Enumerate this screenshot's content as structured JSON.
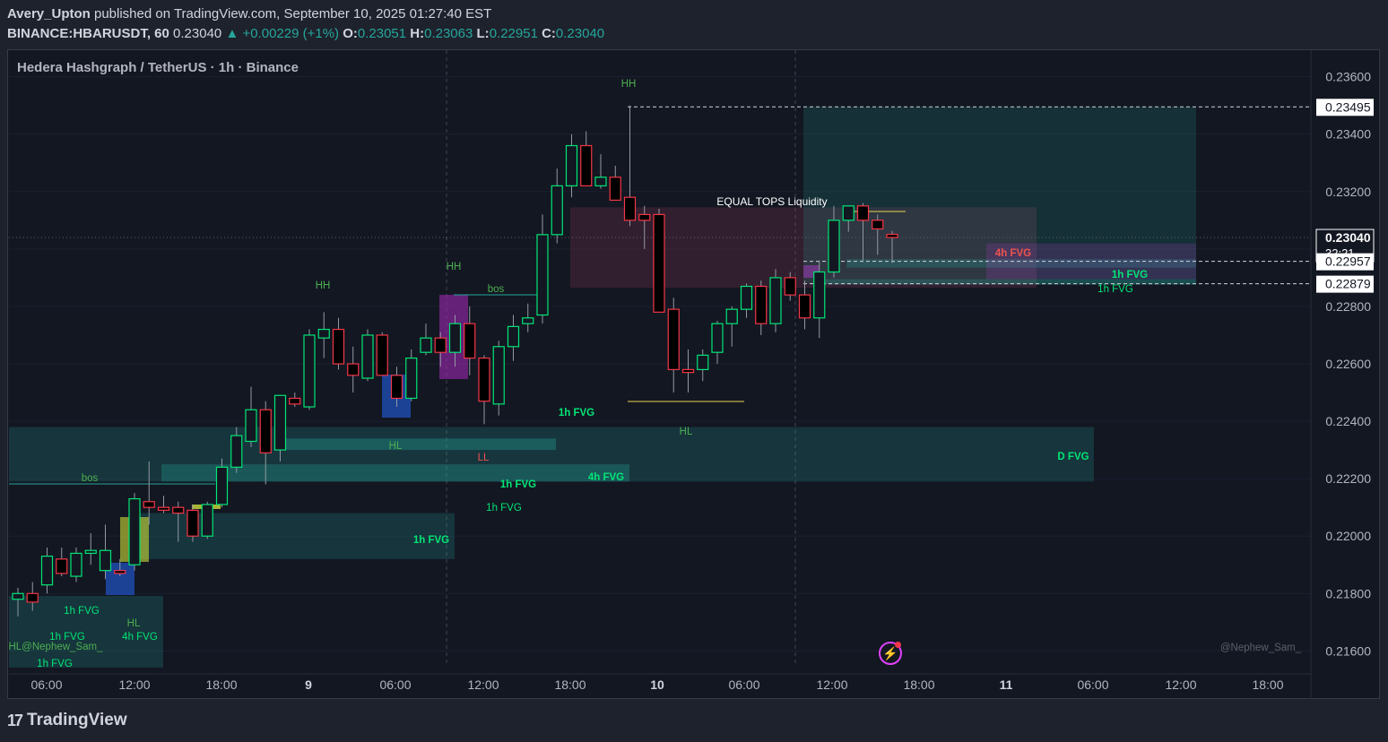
{
  "header": {
    "author": "Avery_Upton",
    "published_text": "published on TradingView.com, September 10, 2025 01:27:40 EST",
    "symbol": "BINANCE:HBARUSDT, 60",
    "price": "0.23040",
    "change": "▲ +0.00229 (+1%)",
    "o_label": "O:",
    "o": "0.23051",
    "h_label": "H:",
    "h": "0.23063",
    "l_label": "L:",
    "l": "0.22951",
    "c_label": "C:",
    "c": "0.23040"
  },
  "legend": {
    "title": "Hedera Hashgraph / TetherUS · 1h · Binance"
  },
  "colors": {
    "up": "#26a69a",
    "down": "#ef5350",
    "bg": "#131722",
    "accent": "#e040fb"
  },
  "chart_data": {
    "type": "candlestick",
    "y_axis": {
      "ylim": [
        0.2152,
        0.2368
      ],
      "ticks": [
        "0.23600",
        "0.23400",
        "0.23200",
        "0.23000",
        "0.22800",
        "0.22600",
        "0.22400",
        "0.22200",
        "0.22000",
        "0.21800",
        "0.21600"
      ]
    },
    "x_axis": {
      "tick_labels": [
        "06:00",
        "12:00",
        "18:00",
        "9",
        "06:00",
        "12:00",
        "18:00",
        "10",
        "06:00",
        "12:00",
        "18:00",
        "11",
        "06:00",
        "12:00",
        "18:00"
      ]
    },
    "price_labels": [
      {
        "value": "0.23495",
        "style": "white"
      },
      {
        "value": "0.23040",
        "countdown": "32:21",
        "style": "current"
      },
      {
        "value": "0.22957",
        "style": "white"
      },
      {
        "value": "0.22879",
        "style": "white"
      }
    ],
    "zones": [
      {
        "label": "D FVG",
        "from": 0.2219,
        "to": 0.2238,
        "kind": "green"
      },
      {
        "label": "4h FVG",
        "from": 0.22865,
        "to": 0.23145,
        "kind": "red"
      },
      {
        "label": "4h FVG",
        "from": 0.2219,
        "to": 0.2225,
        "kind": "green"
      },
      {
        "label": "1h FVG",
        "from": 0.2192,
        "to": 0.2208,
        "kind": "green"
      },
      {
        "label": "1h FVG",
        "from": 0.223,
        "to": 0.2234,
        "kind": "teal"
      },
      {
        "label": "1h FVG",
        "from": 0.22935,
        "to": 0.22965,
        "kind": "green"
      },
      {
        "label": "1h FVG",
        "from": 0.22875,
        "to": 0.22895,
        "kind": "green"
      }
    ],
    "annotations": [
      "HH",
      "HH",
      "HH",
      "HL",
      "HL",
      "HL",
      "LL",
      "bos",
      "bos",
      "EQUAL TOPS Liquidity",
      "1h FVG",
      "1h FVG",
      "1h FVG",
      "4h FVG",
      "1h FVG",
      "HL@Nephew_Sam_",
      "1h FVG"
    ],
    "watermark": "@Nephew_Sam_",
    "candles": [
      [
        0.2178,
        0.2182,
        0.2172,
        0.218
      ],
      [
        0.218,
        0.2184,
        0.2174,
        0.2177
      ],
      [
        0.2183,
        0.2196,
        0.218,
        0.2193
      ],
      [
        0.2192,
        0.2196,
        0.2186,
        0.2187
      ],
      [
        0.2186,
        0.2196,
        0.2184,
        0.2194
      ],
      [
        0.2194,
        0.2201,
        0.219,
        0.2195
      ],
      [
        0.2188,
        0.2204,
        0.2185,
        0.2195
      ],
      [
        0.2188,
        0.2192,
        0.2186,
        0.2187
      ],
      [
        0.219,
        0.2215,
        0.2188,
        0.2213
      ],
      [
        0.2212,
        0.2226,
        0.2204,
        0.221
      ],
      [
        0.221,
        0.2214,
        0.2208,
        0.2209
      ],
      [
        0.221,
        0.2212,
        0.2198,
        0.2208
      ],
      [
        0.2209,
        0.2211,
        0.2198,
        0.22
      ],
      [
        0.22,
        0.2212,
        0.2199,
        0.2211
      ],
      [
        0.2211,
        0.2227,
        0.221,
        0.2224
      ],
      [
        0.2224,
        0.2238,
        0.2222,
        0.2235
      ],
      [
        0.2233,
        0.2252,
        0.2231,
        0.2244
      ],
      [
        0.2244,
        0.2247,
        0.2218,
        0.2229
      ],
      [
        0.223,
        0.2248,
        0.2226,
        0.2249
      ],
      [
        0.2248,
        0.225,
        0.2245,
        0.2246
      ],
      [
        0.2245,
        0.2272,
        0.2244,
        0.227
      ],
      [
        0.2269,
        0.2278,
        0.2262,
        0.2272
      ],
      [
        0.2272,
        0.2276,
        0.2258,
        0.226
      ],
      [
        0.226,
        0.2266,
        0.225,
        0.2256
      ],
      [
        0.2255,
        0.2272,
        0.2254,
        0.227
      ],
      [
        0.227,
        0.2271,
        0.2257,
        0.2256
      ],
      [
        0.2256,
        0.2259,
        0.2245,
        0.2248
      ],
      [
        0.2248,
        0.2265,
        0.2247,
        0.2262
      ],
      [
        0.2264,
        0.2274,
        0.2263,
        0.2269
      ],
      [
        0.2269,
        0.2271,
        0.2259,
        0.2264
      ],
      [
        0.2264,
        0.2277,
        0.2259,
        0.2274
      ],
      [
        0.2274,
        0.228,
        0.2256,
        0.2262
      ],
      [
        0.2262,
        0.2263,
        0.2239,
        0.2247
      ],
      [
        0.2246,
        0.2268,
        0.2242,
        0.2266
      ],
      [
        0.2266,
        0.2277,
        0.2261,
        0.2273
      ],
      [
        0.2274,
        0.2281,
        0.2271,
        0.2276
      ],
      [
        0.2277,
        0.2312,
        0.2274,
        0.2305
      ],
      [
        0.2305,
        0.2328,
        0.2302,
        0.2322
      ],
      [
        0.2322,
        0.234,
        0.2318,
        0.2336
      ],
      [
        0.2336,
        0.2341,
        0.2322,
        0.2322
      ],
      [
        0.2322,
        0.2333,
        0.2321,
        0.2325
      ],
      [
        0.2325,
        0.2329,
        0.2317,
        0.2317
      ],
      [
        0.2318,
        0.235,
        0.2308,
        0.231
      ],
      [
        0.2312,
        0.2315,
        0.23,
        0.231
      ],
      [
        0.2312,
        0.2314,
        0.228,
        0.2278
      ],
      [
        0.2279,
        0.2283,
        0.225,
        0.2258
      ],
      [
        0.2258,
        0.2265,
        0.225,
        0.2257
      ],
      [
        0.2258,
        0.2265,
        0.2254,
        0.2263
      ],
      [
        0.2264,
        0.2275,
        0.226,
        0.2274
      ],
      [
        0.2274,
        0.228,
        0.2266,
        0.2279
      ],
      [
        0.2279,
        0.2288,
        0.2276,
        0.2287
      ],
      [
        0.2287,
        0.2289,
        0.227,
        0.2274
      ],
      [
        0.2274,
        0.2293,
        0.2271,
        0.229
      ],
      [
        0.229,
        0.2292,
        0.2282,
        0.2284
      ],
      [
        0.2284,
        0.2289,
        0.2272,
        0.2276
      ],
      [
        0.2276,
        0.2296,
        0.2269,
        0.2292
      ],
      [
        0.2292,
        0.2315,
        0.229,
        0.231
      ],
      [
        0.231,
        0.2315,
        0.2306,
        0.2315
      ],
      [
        0.2315,
        0.2316,
        0.2296,
        0.231
      ],
      [
        0.231,
        0.2312,
        0.2298,
        0.2307
      ],
      [
        0.23051,
        0.23063,
        0.22951,
        0.2304
      ]
    ]
  }
}
